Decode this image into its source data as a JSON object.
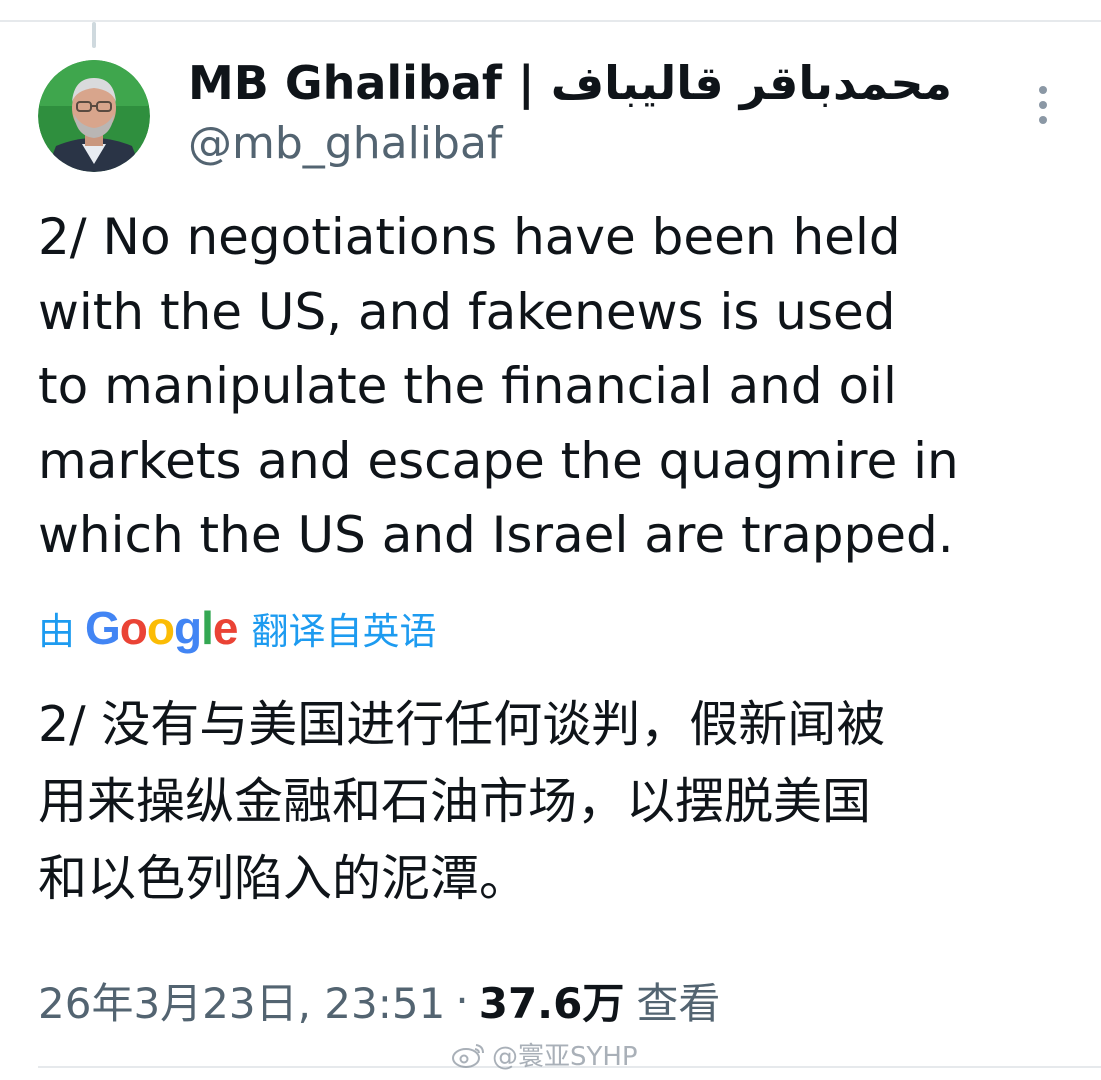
{
  "tweet": {
    "display_name": "MB Ghalibaf | محمدباقر قالیباف",
    "handle": "@mb_ghalibaf",
    "text_lines": [
      "2/ No negotiations have been held",
      "with the US, and fakenews is used",
      "to manipulate the financial and oil",
      "markets and escape the quagmire in",
      "which the US and Israel are trapped."
    ],
    "translation": {
      "prefix": "由",
      "provider": "Google",
      "suffix": "翻译自英语",
      "text_lines": [
        "2/ 没有与美国进行任何谈判，假新闻被",
        "用来操纵金融和石油市场，以摆脱美国",
        "和以色列陷入的泥潭。"
      ]
    },
    "timestamp": "26年3月23日, 23:51",
    "separator": "·",
    "views_count": "37.6万",
    "views_label": "查看"
  },
  "watermark": {
    "text": "@寰亚SYHP"
  },
  "colors": {
    "text_primary": "#0f1419",
    "text_secondary": "#536471",
    "link_blue": "#1d9bf0",
    "google_blue": "#4285F4",
    "google_red": "#EA4335",
    "google_yellow": "#FBBC05",
    "google_green": "#34A853",
    "divider": "#e6e9ec"
  },
  "icons": {
    "avatar": "profile-photo",
    "more": "more-vertical-icon",
    "watermark": "weibo-icon"
  }
}
